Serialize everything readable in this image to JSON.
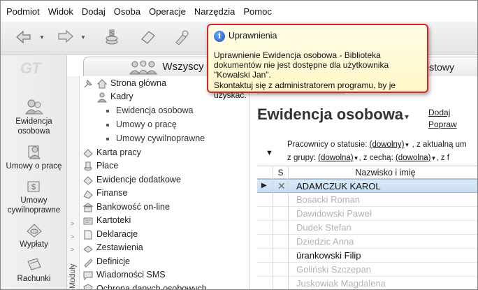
{
  "menu": [
    "Podmiot",
    "Widok",
    "Dodaj",
    "Osoba",
    "Operacje",
    "Narzędzia",
    "Pomoc"
  ],
  "logo": "GT",
  "leftnav": [
    {
      "label": "Ewidencja\nosobowa"
    },
    {
      "label": "Umowy o pracę"
    },
    {
      "label": "Umowy\ncywilnoprawne"
    },
    {
      "label": "Wypłaty"
    },
    {
      "label": "Rachunki"
    }
  ],
  "tabs": {
    "active": "Wszyscy",
    "right": "estowy"
  },
  "tree": {
    "items": [
      "Strona główna",
      "Kadry",
      "Ewidencja osobowa",
      "Umowy o pracę",
      "Umowy cywilnoprawne",
      "Karta pracy",
      "Płace",
      "Ewidencje dodatkowe",
      "Finanse",
      "Bankowość on-line",
      "Kartoteki",
      "Deklaracje",
      "Zestawienia",
      "Definicje",
      "Wiadomości SMS",
      "Ochrona danych osobowych"
    ],
    "vertical_label": "Moduły"
  },
  "content": {
    "title": "Ewidencja osobowa",
    "actions": [
      "Dodaj",
      "Popraw"
    ],
    "filters": {
      "status_label": "Pracownicy o statusie:",
      "status_value": "(dowolny)",
      "status_suffix": ", z aktualną um",
      "group_label": "z grupy:",
      "group_value": "(dowolna)",
      "feature_label": ", z cechą:",
      "feature_value": "(dowolna)",
      "feature_suffix": ", z f"
    },
    "grid": {
      "col_s": "S",
      "col_name": "Nazwisko i imię",
      "rows": [
        "ADAMCZUK KAROL",
        "Bosacki Roman",
        "Dawidowski Paweł",
        "Dudek Stefan",
        "Dziedzic Anna",
        "ürankowski Filip",
        "Goliński Szczepan",
        "Juskowiak Magdalena"
      ]
    }
  },
  "tooltip": {
    "title": "Uprawnienia",
    "body": "Uprawnienie Ewidencja osobowa - Biblioteka dokumentów nie jest dostępne dla użytkownika \"Kowalski Jan\".",
    "foot": "Skontaktuj się z administratorem programu, by je uzyskać."
  },
  "colors": {
    "selection": "#c8dcf2",
    "tooltip_border": "#e02020",
    "tooltip_bg": "#fff6c8"
  }
}
